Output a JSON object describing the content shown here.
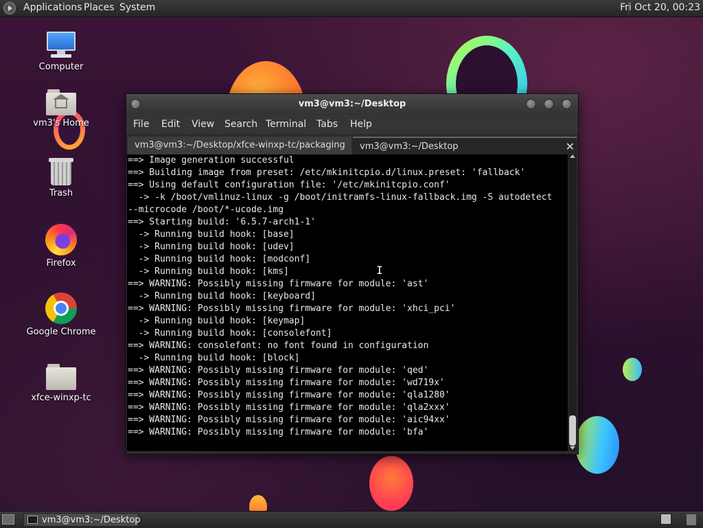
{
  "top_panel": {
    "menu": [
      "Applications",
      "Places",
      "System"
    ],
    "clock": "Fri Oct 20, 00:23"
  },
  "desktop_icons": [
    {
      "label": "Computer",
      "icon": "computer-icon"
    },
    {
      "label": "vm3's Home",
      "icon": "home-folder-icon"
    },
    {
      "label": "Trash",
      "icon": "trash-icon"
    },
    {
      "label": "Firefox",
      "icon": "firefox-icon"
    },
    {
      "label": "Google Chrome",
      "icon": "chrome-icon"
    },
    {
      "label": "xfce-winxp-tc",
      "icon": "folder-icon"
    }
  ],
  "window": {
    "title": "vm3@vm3:~/Desktop",
    "menu": [
      "File",
      "Edit",
      "View",
      "Search",
      "Terminal",
      "Tabs",
      "Help"
    ],
    "tabs": [
      {
        "label": "vm3@vm3:~/Desktop/xfce-winxp-tc/packaging",
        "active": false
      },
      {
        "label": "vm3@vm3:~/Desktop",
        "active": true
      }
    ],
    "terminal_lines": [
      "==> Image generation successful",
      "==> Building image from preset: /etc/mkinitcpio.d/linux.preset: 'fallback'",
      "==> Using default configuration file: '/etc/mkinitcpio.conf'",
      "  -> -k /boot/vmlinuz-linux -g /boot/initramfs-linux-fallback.img -S autodetect",
      "--microcode /boot/*-ucode.img",
      "==> Starting build: '6.5.7-arch1-1'",
      "  -> Running build hook: [base]",
      "  -> Running build hook: [udev]",
      "  -> Running build hook: [modconf]",
      "  -> Running build hook: [kms]",
      "==> WARNING: Possibly missing firmware for module: 'ast'",
      "  -> Running build hook: [keyboard]",
      "==> WARNING: Possibly missing firmware for module: 'xhci_pci'",
      "  -> Running build hook: [keymap]",
      "  -> Running build hook: [consolefont]",
      "==> WARNING: consolefont: no font found in configuration",
      "  -> Running build hook: [block]",
      "==> WARNING: Possibly missing firmware for module: 'qed'",
      "==> WARNING: Possibly missing firmware for module: 'wd719x'",
      "==> WARNING: Possibly missing firmware for module: 'qla1280'",
      "==> WARNING: Possibly missing firmware for module: 'qla2xxx'",
      "==> WARNING: Possibly missing firmware for module: 'aic94xx'",
      "==> WARNING: Possibly missing firmware for module: 'bfa'"
    ]
  },
  "taskbar": {
    "tasks": [
      {
        "label": "vm3@vm3:~/Desktop"
      }
    ]
  }
}
